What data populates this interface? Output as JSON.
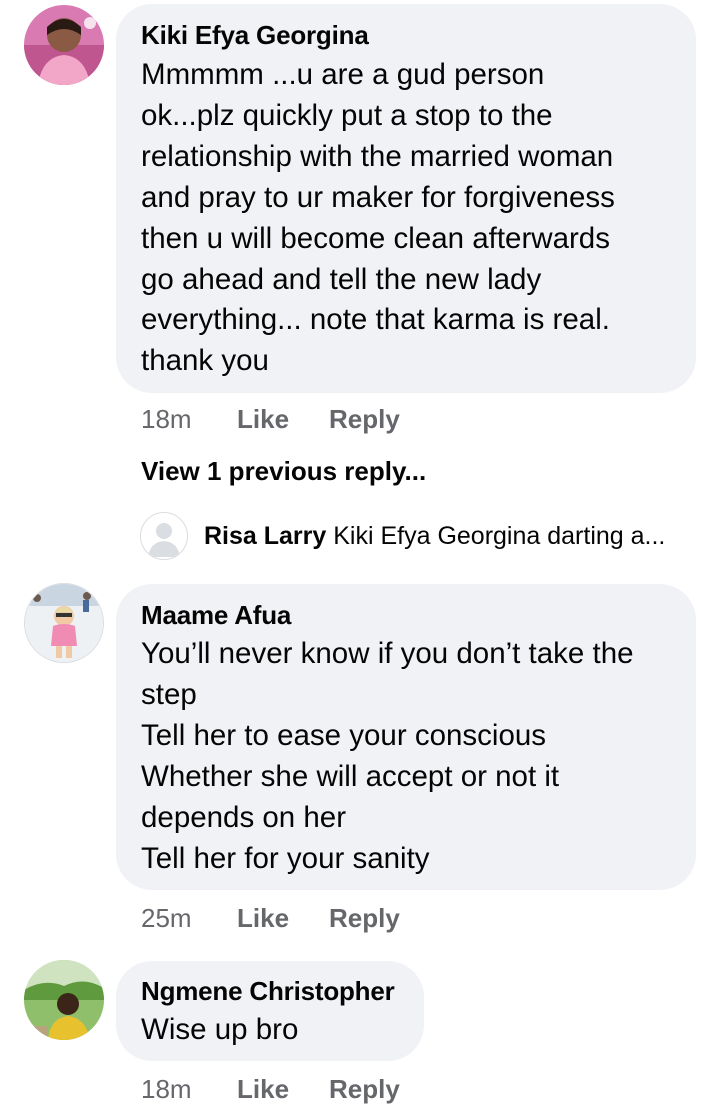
{
  "comments": [
    {
      "author": "Kiki Efya Georgina",
      "text": "Mmmmm ...u are a gud person\nok...plz quickly put a stop to the\nrelationship with the married woman\nand pray to ur maker for forgiveness\nthen u will become clean afterwards\ngo ahead and tell the new lady\neverything... note that karma is real.\nthank you",
      "time": "18m",
      "like_label": "Like",
      "reply_label": "Reply",
      "view_previous_label": "View 1 previous reply...",
      "reply_preview": {
        "author": "Risa Larry",
        "text": "Kiki Efya Georgina darting a..."
      }
    },
    {
      "author": "Maame Afua",
      "text": "You’ll never know if you don’t take the\nstep\nTell her to ease your conscious\nWhether she will accept or not it\ndepends on her\nTell her for your sanity",
      "time": "25m",
      "like_label": "Like",
      "reply_label": "Reply"
    },
    {
      "author": "Ngmene Christopher",
      "text": "Wise up bro",
      "time": "18m",
      "like_label": "Like",
      "reply_label": "Reply"
    }
  ]
}
